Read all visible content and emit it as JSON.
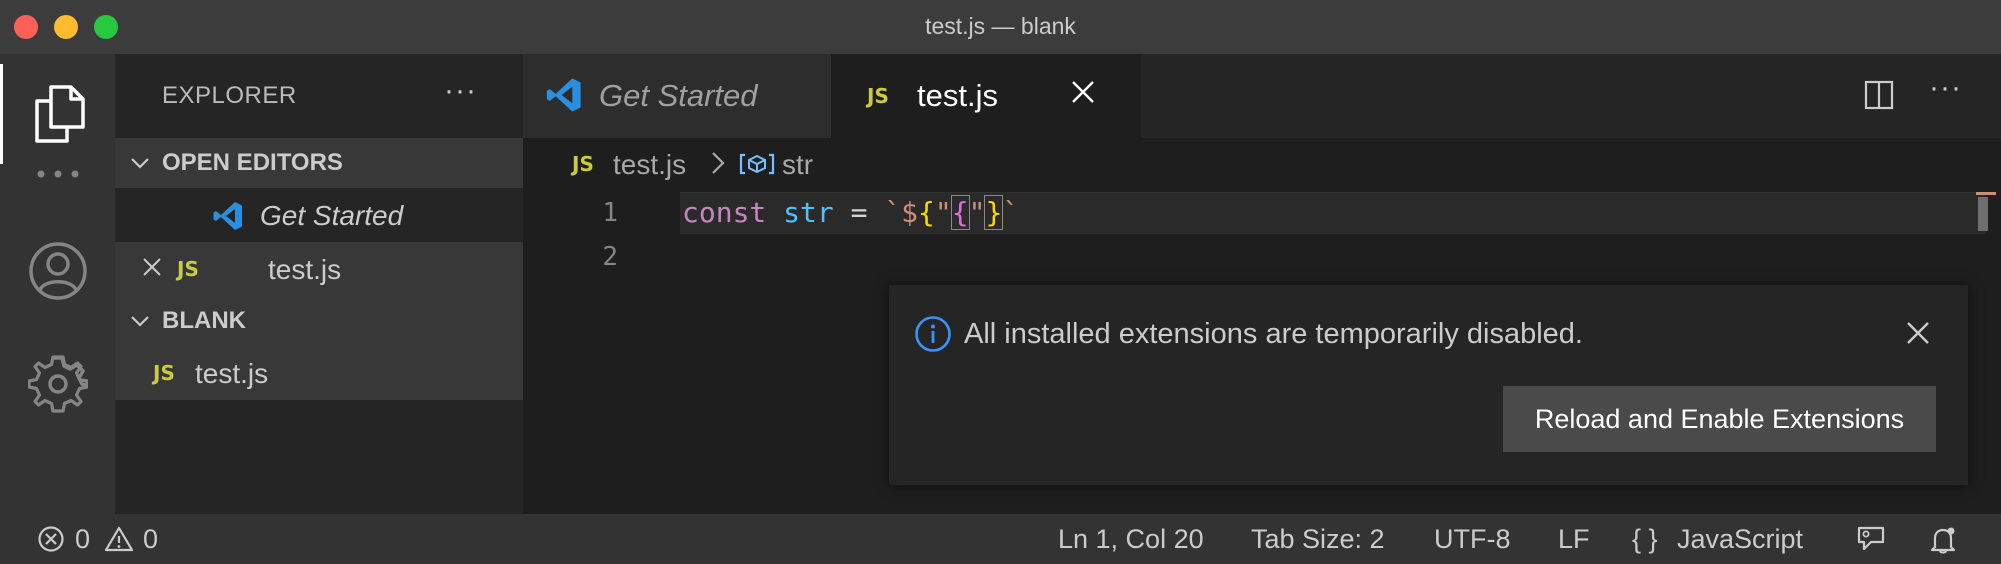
{
  "window": {
    "title": "test.js — blank"
  },
  "activity_bar": {
    "items": [
      "explorer-icon",
      "more-icon",
      "account-icon",
      "settings-icon"
    ],
    "more_label": "···"
  },
  "sidebar": {
    "title": "EXPLORER",
    "more_label": "···",
    "open_editors": {
      "label": "OPEN EDITORS",
      "items": [
        {
          "name": "Get Started",
          "icon": "vscode-logo-icon",
          "italic": true
        },
        {
          "name": "test.js",
          "icon": "js-file-icon",
          "file_tag": "JS",
          "dirty_close": true
        }
      ]
    },
    "folder": {
      "label": "BLANK",
      "items": [
        {
          "name": "test.js",
          "icon": "js-file-icon",
          "file_tag": "JS"
        }
      ]
    }
  },
  "tabs": [
    {
      "label": "Get Started",
      "active": false,
      "icon": "vscode-logo-icon"
    },
    {
      "label": "test.js",
      "active": true,
      "file_tag": "JS"
    }
  ],
  "editor_actions": {
    "more_label": "···"
  },
  "breadcrumb": {
    "file_tag": "JS",
    "file": "test.js",
    "symbol": "str"
  },
  "editor": {
    "line_numbers": [
      "1",
      "2"
    ],
    "tokens": {
      "kw": "const",
      "var": "str",
      "op": "=",
      "tick_open": "`",
      "dollar": "$",
      "brace_open": "{",
      "q1": "\"",
      "lit": "{",
      "q2": "\"",
      "brace_close": "}",
      "tick_close": "`"
    }
  },
  "notification": {
    "message": "All installed extensions are temporarily disabled.",
    "button_label": "Reload and Enable Extensions"
  },
  "status_bar": {
    "errors": "0",
    "warnings": "0",
    "position": "Ln 1, Col 20",
    "tab_size": "Tab Size: 2",
    "encoding": "UTF-8",
    "eol": "LF",
    "language_icon": "{ }",
    "language": "JavaScript"
  },
  "colors": {
    "title_bar": "#3c3c3c",
    "activity_bar": "#333333",
    "sidebar": "#252526",
    "editor": "#1e1e1e",
    "js_icon": "#cbcb41",
    "vscode_blue": "#2b8fe0",
    "info_blue": "#3794ff"
  }
}
